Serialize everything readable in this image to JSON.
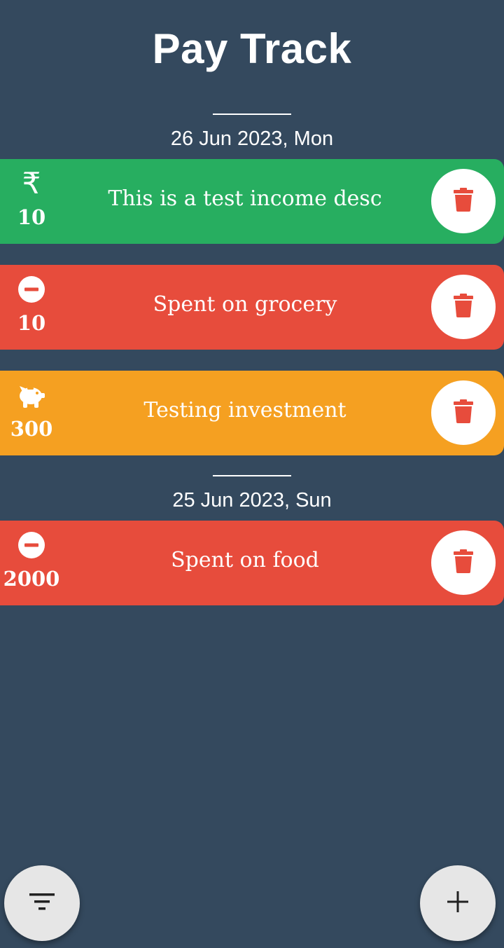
{
  "app": {
    "title": "Pay Track"
  },
  "colors": {
    "background": "#34495e",
    "income": "#27ae60",
    "expense": "#e74c3c",
    "investment": "#f5a021",
    "delete_icon": "#e74c3c",
    "fab": "#e6e6e6"
  },
  "groups": [
    {
      "date": "26 Jun 2023, Mon",
      "transactions": [
        {
          "type": "income",
          "icon": "rupee-icon",
          "amount": "10",
          "description": "This is a test income desc"
        },
        {
          "type": "expense",
          "icon": "minus-circle-icon",
          "amount": "10",
          "description": "Spent on grocery"
        },
        {
          "type": "investment",
          "icon": "piggy-bank-icon",
          "amount": "300",
          "description": "Testing investment"
        }
      ]
    },
    {
      "date": "25 Jun 2023, Sun",
      "transactions": [
        {
          "type": "expense",
          "icon": "minus-circle-icon",
          "amount": "2000",
          "description": "Spent on food"
        }
      ]
    }
  ],
  "actions": {
    "filter_icon": "filter-icon",
    "add_icon": "plus-icon",
    "delete_icon": "trash-icon"
  }
}
